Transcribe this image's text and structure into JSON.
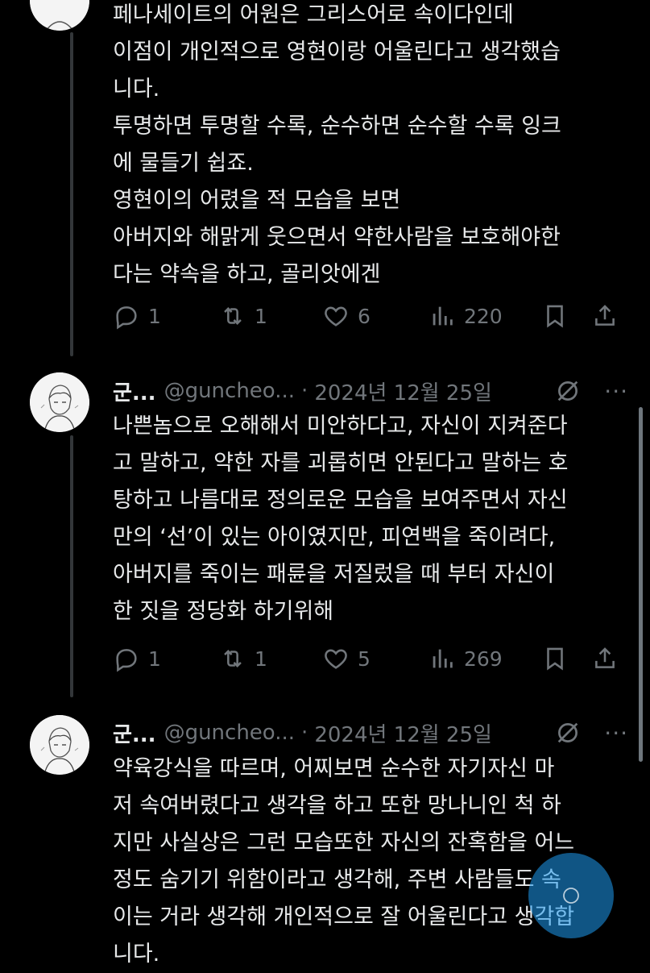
{
  "tweets": [
    {
      "lines": [
        "페나세이트의 어원은 그리스어로 속이다인데",
        "이점이 개인적으로 영현이랑 어울린다고 생각했습",
        "니다.",
        "투명하면 투명할 수록, 순수하면 순수할 수록 잉크",
        "에 물들기 쉽죠.",
        "영현이의 어렸을 적 모습을 보면",
        "아버지와 해맑게 웃으면서 약한사람을 보호해야한",
        "다는 약속을 하고, 골리앗에겐"
      ],
      "stats": {
        "replies": "1",
        "reposts": "1",
        "likes": "6",
        "views": "220"
      }
    },
    {
      "name": "군...",
      "handle": "@guncheo...",
      "separator": "·",
      "date": "2024년 12월 25일",
      "lines": [
        "나쁜놈으로 오해해서 미안하다고, 자신이 지켜준다",
        "고 말하고, 약한 자를 괴롭히면 안된다고 말하는 호",
        "탕하고 나름대로 정의로운 모습을 보여주면서 자신",
        "만의 ‘선’이 있는 아이였지만, 피연백을 죽이려다,",
        "아버지를 죽이는 패륜을 저질렀을 때 부터 자신이",
        "한 짓을 정당화 하기위해"
      ],
      "stats": {
        "replies": "1",
        "reposts": "1",
        "likes": "5",
        "views": "269"
      }
    },
    {
      "name": "군...",
      "handle": "@guncheo...",
      "separator": "·",
      "date": "2024년 12월 25일",
      "lines": [
        "약육강식을 따르며, 어찌보면 순수한 자기자신 마",
        "저 속여버렸다고 생각을 하고 또한 망나니인 척 하",
        "지만 사실상은 그런 모습또한 자신의 잔혹함을 어느",
        "정도 숨기기 위함이라고 생각해, 주변 사람들도 속",
        "이는 거라 생각해 개인적으로 잘 어울린다고 생각합",
        "니다."
      ]
    }
  ],
  "more_label": "···",
  "icons": {
    "reply": "reply-icon",
    "repost": "repost-icon",
    "like": "like-icon",
    "views": "views-icon",
    "bookmark": "bookmark-icon",
    "share": "share-icon",
    "grok": "grok-icon",
    "more": "more-icon"
  },
  "colors": {
    "background": "#000000",
    "text": "#e7e9ea",
    "muted": "#71767b",
    "accent": "#1d9bf0"
  }
}
